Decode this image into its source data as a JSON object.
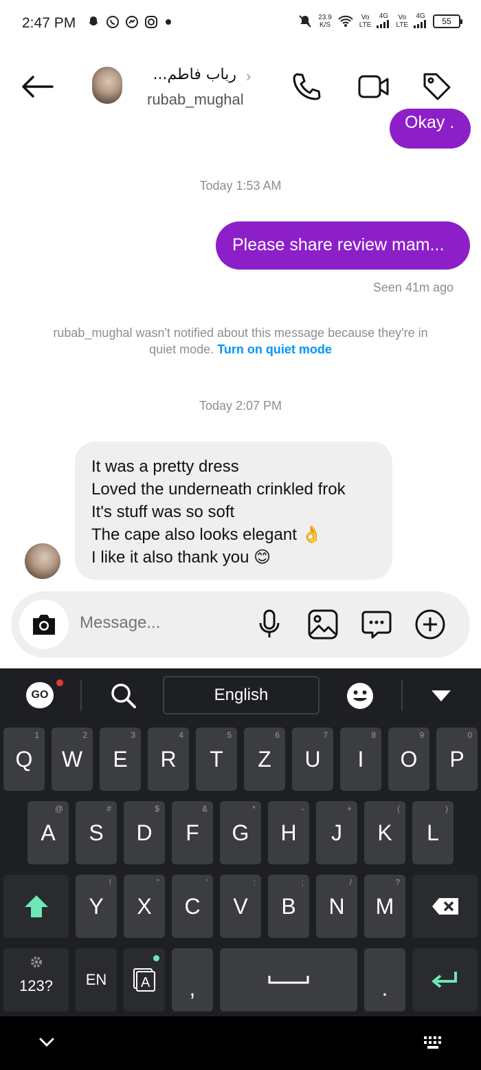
{
  "status_bar": {
    "time": "2:47 PM",
    "speed_value": "23.9",
    "speed_unit": "K/S",
    "net1_top": "Vo",
    "net1_bottom": "LTE",
    "net1_gen": "4G",
    "net2_top": "Vo",
    "net2_bottom": "LTE",
    "net2_gen": "4G",
    "battery": "55",
    "left_icons": [
      "snapchat-icon",
      "whatsapp-icon",
      "messenger-icon",
      "instagram-icon",
      "dot-icon"
    ],
    "right_icons": [
      "mute-icon",
      "wifi-icon",
      "signal-icon",
      "battery-icon"
    ]
  },
  "header": {
    "contact_name": "رباب فاطم...",
    "username": "rubab_mughal",
    "chevron": "›",
    "icons": [
      "back-arrow-icon",
      "phone-icon",
      "video-icon",
      "tag-icon"
    ]
  },
  "chat": {
    "partial_message": "Okay .",
    "timestamp_1": "Today 1:53 AM",
    "sent_message": "Please share review mam...",
    "seen": "Seen 41m ago",
    "quiet_note_prefix": "rubab_mughal wasn't notified about this message because they're in quiet mode.",
    "quiet_link": "Turn on quiet mode",
    "timestamp_2": "Today 2:07 PM",
    "received_lines": [
      "It was a pretty dress",
      "Loved the underneath crinkled frok",
      "It's stuff was so soft",
      "The cape also looks elegant 👌",
      "I like it also thank you 😊"
    ]
  },
  "composer": {
    "placeholder": "Message...",
    "icons": [
      "camera-icon",
      "microphone-icon",
      "gallery-icon",
      "sticker-icon",
      "plus-icon"
    ]
  },
  "keyboard": {
    "go_label": "GO",
    "language": "English",
    "row1": [
      [
        "Q",
        "1"
      ],
      [
        "W",
        "2"
      ],
      [
        "E",
        "3"
      ],
      [
        "R",
        "4"
      ],
      [
        "T",
        "5"
      ],
      [
        "Z",
        "6"
      ],
      [
        "U",
        "7"
      ],
      [
        "I",
        "8"
      ],
      [
        "O",
        "9"
      ],
      [
        "P",
        "0"
      ]
    ],
    "row2": [
      [
        "A",
        "@"
      ],
      [
        "S",
        "#"
      ],
      [
        "D",
        "$"
      ],
      [
        "F",
        "&"
      ],
      [
        "G",
        "*"
      ],
      [
        "H",
        "-"
      ],
      [
        "J",
        "+"
      ],
      [
        "K",
        "("
      ],
      [
        "L",
        ")"
      ]
    ],
    "row3": [
      [
        "Y",
        "!"
      ],
      [
        "X",
        "\""
      ],
      [
        "C",
        "'"
      ],
      [
        "V",
        ":"
      ],
      [
        "B",
        ";"
      ],
      [
        "N",
        "/"
      ],
      [
        "M",
        "?"
      ]
    ],
    "num_key": "123?",
    "lang_key": "EN",
    "comma": ",",
    "period": ".",
    "accent_color": "#6ee7b7"
  },
  "colors": {
    "outgoing_bubble": "#8d1fc9",
    "incoming_bubble": "#efefef",
    "link": "#0095f6",
    "keyboard_bg": "#1e1f22",
    "key_bg": "#3c3d41"
  }
}
